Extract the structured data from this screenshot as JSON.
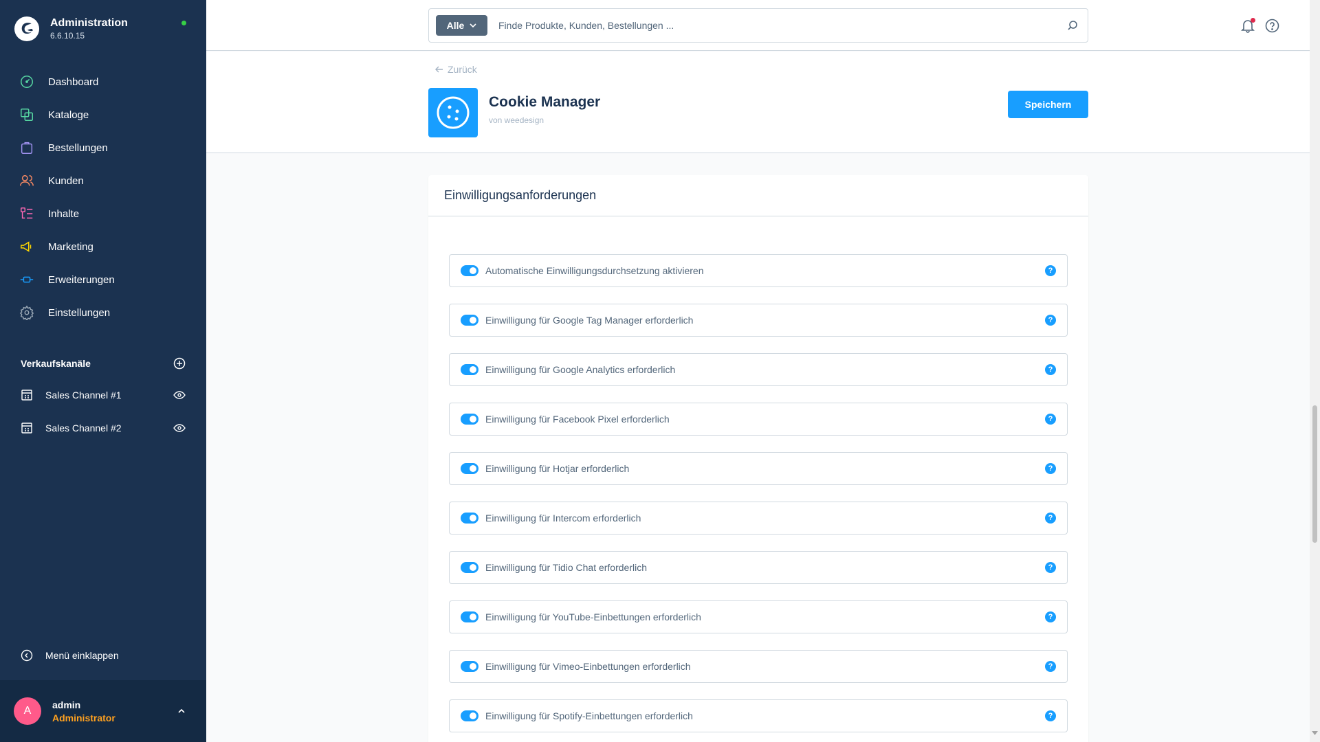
{
  "app": {
    "title": "Administration",
    "version": "6.6.10.15"
  },
  "nav": {
    "items": [
      {
        "label": "Dashboard",
        "icon": "dashboard-icon",
        "color": "#57d9a3"
      },
      {
        "label": "Kataloge",
        "icon": "catalog-icon",
        "color": "#57d9a3"
      },
      {
        "label": "Bestellungen",
        "icon": "orders-icon",
        "color": "#a092f0"
      },
      {
        "label": "Kunden",
        "icon": "customers-icon",
        "color": "#f88962"
      },
      {
        "label": "Inhalte",
        "icon": "content-icon",
        "color": "#ff68b4"
      },
      {
        "label": "Marketing",
        "icon": "marketing-icon",
        "color": "#ffd700"
      },
      {
        "label": "Erweiterungen",
        "icon": "extensions-icon",
        "color": "#189eff"
      },
      {
        "label": "Einstellungen",
        "icon": "settings-icon",
        "color": "#9aa8b5"
      }
    ]
  },
  "channels": {
    "title": "Verkaufskanäle",
    "items": [
      {
        "label": "Sales Channel #1"
      },
      {
        "label": "Sales Channel #2"
      }
    ]
  },
  "collapse_label": "Menü einklappen",
  "user": {
    "initial": "A",
    "name": "admin",
    "role": "Administrator"
  },
  "search": {
    "type_label": "Alle",
    "placeholder": "Finde Produkte, Kunden, Bestellungen ..."
  },
  "header": {
    "back_label": "Zurück",
    "plugin_title": "Cookie Manager",
    "plugin_author": "von weedesign",
    "save_label": "Speichern"
  },
  "card": {
    "title": "Einwilligungsanforderungen",
    "rows": [
      {
        "label": "Automatische Einwilligungsdurchsetzung aktivieren",
        "enabled": true
      },
      {
        "label": "Einwilligung für Google Tag Manager erforderlich",
        "enabled": true
      },
      {
        "label": "Einwilligung für Google Analytics erforderlich",
        "enabled": true
      },
      {
        "label": "Einwilligung für Facebook Pixel erforderlich",
        "enabled": true
      },
      {
        "label": "Einwilligung für Hotjar erforderlich",
        "enabled": true
      },
      {
        "label": "Einwilligung für Intercom erforderlich",
        "enabled": true
      },
      {
        "label": "Einwilligung für Tidio Chat erforderlich",
        "enabled": true
      },
      {
        "label": "Einwilligung für YouTube-Einbettungen erforderlich",
        "enabled": true
      },
      {
        "label": "Einwilligung für Vimeo-Einbettungen erforderlich",
        "enabled": true
      },
      {
        "label": "Einwilligung für Spotify-Einbettungen erforderlich",
        "enabled": true
      }
    ],
    "help_glyph": "?"
  },
  "colors": {
    "sidebar_bg": "#1b3250",
    "accent": "#189eff",
    "status_online": "#37d046",
    "notification": "#de294c",
    "user_role": "#ffa11f"
  }
}
